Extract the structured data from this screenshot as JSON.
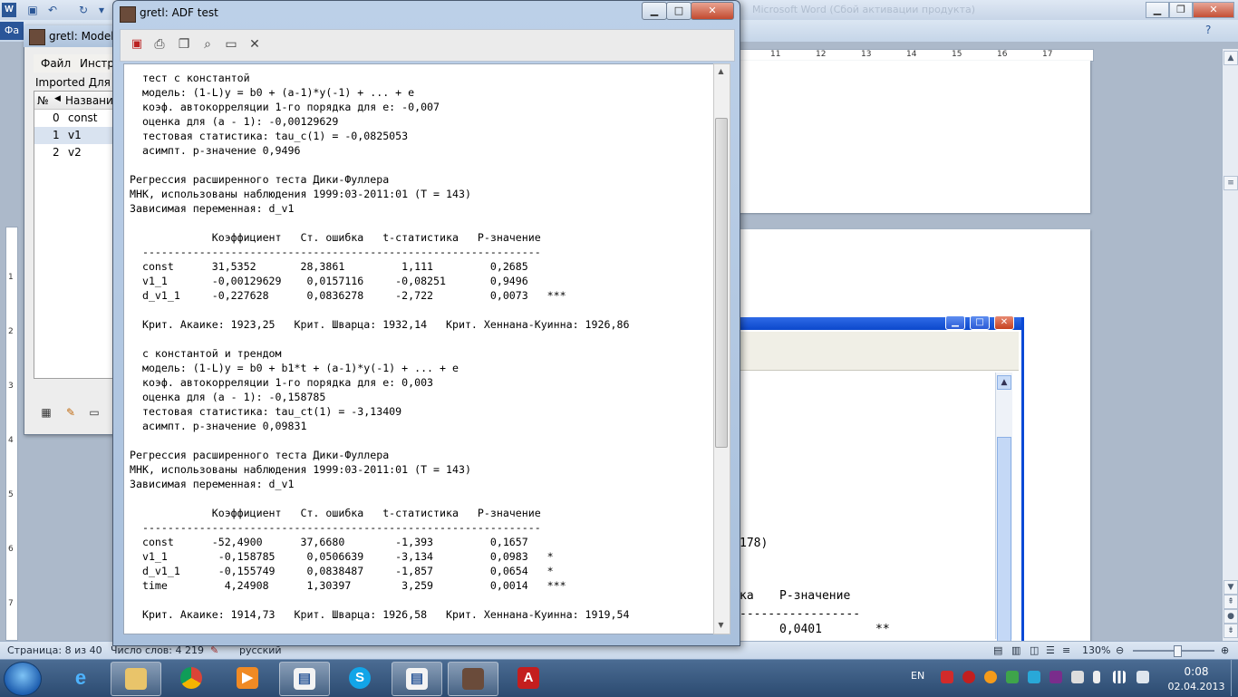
{
  "word": {
    "file_tab": "Фа",
    "title_right": "Microsoft Word (Сбой активации продукта)",
    "help": "?",
    "status": {
      "page": "Страница: 8 из 40",
      "words": "Число слов: 4 219",
      "language": "русский",
      "zoom": "130%"
    },
    "ruler_marks": [
      "11",
      "12",
      "13",
      "14",
      "15",
      "16",
      "17"
    ],
    "ruler_v_marks": [
      "1",
      "2",
      "3",
      "4",
      "5",
      "6",
      "7"
    ],
    "doc_visible": {
      "line1": "178)",
      "header_frag1": "ка",
      "header_frag2": "Р-значение",
      "value": "0,0401",
      "stars": "**"
    }
  },
  "gretl_main": {
    "title": "gretl: Modeli",
    "menu": [
      "Файл",
      "Инстру"
    ],
    "dataset_label": "Imported Для Г",
    "table": {
      "col_no": "№",
      "col_name": "Название",
      "rows": [
        {
          "id": "0",
          "name": "const"
        },
        {
          "id": "1",
          "name": "v1"
        },
        {
          "id": "2",
          "name": "v2"
        }
      ]
    }
  },
  "adf_window": {
    "title": "gretl: ADF test",
    "controls": {
      "minimize": "▁",
      "maximize": "□",
      "close": "✕"
    },
    "text": "  тест с константой\n  модель: (1-L)y = b0 + (a-1)*y(-1) + ... + e\n  коэф. автокорреляции 1-го порядка для e: -0,007\n  оценка для (a - 1): -0,00129629\n  тестовая статистика: tau_c(1) = -0,0825053\n  асимпт. р-значение 0,9496\n\nРегрессия расширенного теста Дики-Фуллера\nМНК, использованы наблюдения 1999:03-2011:01 (T = 143)\nЗависимая переменная: d_v1\n\n             Коэффициент   Ст. ошибка   t-статистика   Р-значение\n  ---------------------------------------------------------------\n  const      31,5352       28,3861         1,111         0,2685\n  v1_1       -0,00129629    0,0157116     -0,08251       0,9496\n  d_v1_1     -0,227628      0,0836278     -2,722         0,0073   ***\n\n  Крит. Акаике: 1923,25   Крит. Шварца: 1932,14   Крит. Хеннана-Куинна: 1926,86\n\n  с константой и трендом\n  модель: (1-L)y = b0 + b1*t + (a-1)*y(-1) + ... + e\n  коэф. автокорреляции 1-го порядка для e: 0,003\n  оценка для (a - 1): -0,158785\n  тестовая статистика: tau_ct(1) = -3,13409\n  асимпт. р-значение 0,09831\n\nРегрессия расширенного теста Дики-Фуллера\nМНК, использованы наблюдения 1999:03-2011:01 (T = 143)\nЗависимая переменная: d_v1\n\n             Коэффициент   Ст. ошибка   t-статистика   Р-значение\n  ---------------------------------------------------------------\n  const      -52,4900      37,6680        -1,393         0,1657\n  v1_1        -0,158785     0,0506639     -3,134         0,0983   *\n  d_v1_1      -0,155749     0,0838487     -1,857         0,0654   *\n  time         4,24908      1,30397        3,259         0,0014   ***\n\n  Крит. Акаике: 1914,73   Крит. Шварца: 1926,58   Крит. Хеннана-Куинна: 1919,54"
  },
  "taskbar": {
    "language": "EN",
    "time": "0:08",
    "date": "02.04.2013"
  },
  "colors": {
    "taskbar": "#2b4a70",
    "xp_blue": "#0a49d6",
    "adf_close": "#c24a2f"
  }
}
